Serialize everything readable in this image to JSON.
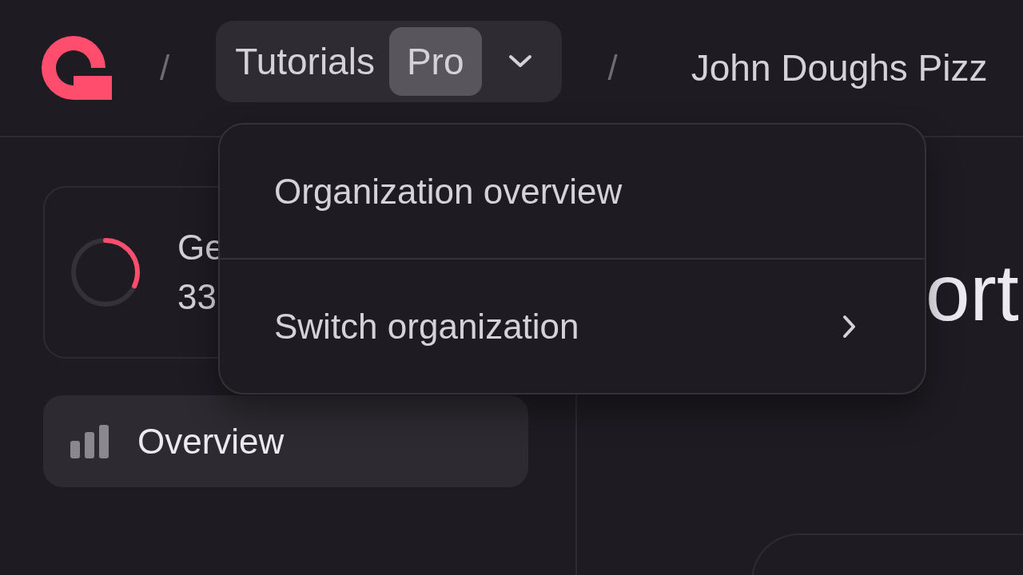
{
  "header": {
    "breadcrumbs": [
      {
        "kind": "separator",
        "text": "/"
      },
      {
        "kind": "org",
        "name": "Tutorials",
        "badge": "Pro",
        "expanded": true
      },
      {
        "kind": "separator",
        "text": "/"
      },
      {
        "kind": "project",
        "text": "John Doughs Pizz"
      }
    ]
  },
  "sidebar": {
    "usage_card": {
      "title": "Ge",
      "value": "33",
      "level": 0.32
    },
    "nav": [
      {
        "label": "Overview",
        "selected": true
      }
    ]
  },
  "main": {
    "heading": "ort"
  },
  "org_menu": {
    "items": [
      {
        "label": "Organization overview",
        "submenu": false
      },
      {
        "label": "Switch organization",
        "submenu": true
      }
    ]
  }
}
